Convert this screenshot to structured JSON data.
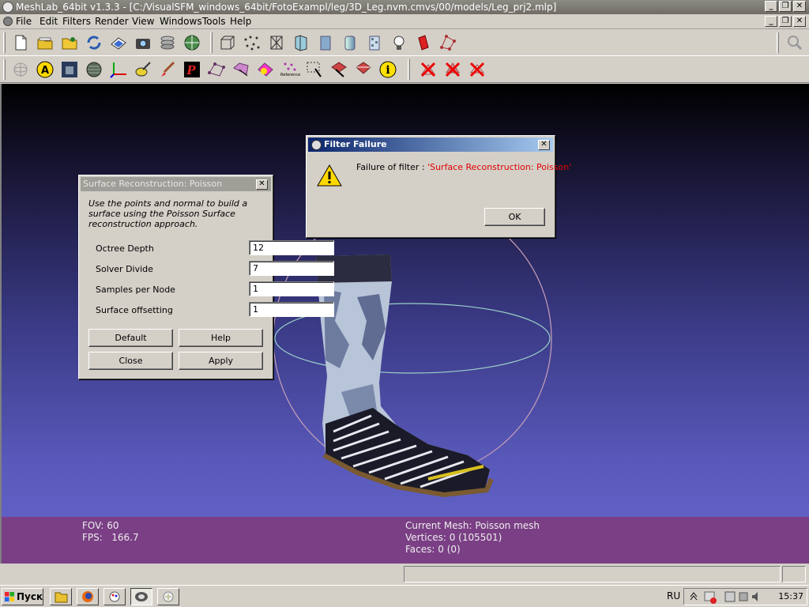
{
  "window": {
    "title": "MeshLab_64bit v1.3.3 - [C:/VisualSFM_windows_64bit/FotoExampl/leg/3D_Leg.nvm.cmvs/00/models/Leg_prj2.mlp]"
  },
  "menu": [
    "File",
    "Edit",
    "Filters",
    "Render",
    "View",
    "Windows",
    "Tools",
    "Help"
  ],
  "toolbar1_icons": [
    "new-project-icon",
    "open-project-icon",
    "open-mesh-icon",
    "reload-icon",
    "save-icon",
    "snapshot-icon",
    "layers-icon",
    "globe-icon",
    "bbox-icon",
    "points-icon",
    "wireframe-icon",
    "hidden-lines-icon",
    "flat-shading-icon",
    "smooth-shading-icon",
    "texture-icon",
    "light-icon",
    "color-icon",
    "vertex-select-icon",
    "search-icon"
  ],
  "toolbar2_icons": [
    "trackball-icon",
    "annotation-icon",
    "texture-proj-icon",
    "globe-edit-icon",
    "axis-icon",
    "measure-icon",
    "paint-icon",
    "pick-points-icon",
    "select-vertices-icon",
    "select-faces-icon",
    "colorize-icon",
    "reference-icon",
    "select-area-icon",
    "select-connected-icon",
    "select-border-icon",
    "info-icon",
    "delete-faces-icon",
    "delete-vertices-icon",
    "delete-selected-icon"
  ],
  "toolbar2_reference_label": "Reference",
  "viewport": {
    "fov_label": "FOV:",
    "fov": "60",
    "fps_label": "FPS:",
    "fps": "166.7",
    "current_mesh": "Current Mesh: Poisson mesh",
    "vertices": "Vertices: 0 (105501)",
    "faces": "Faces: 0 (0)"
  },
  "poisson_dialog": {
    "title": "Surface Reconstruction: Poisson",
    "description": "Use the points and normal to build a surface using the Poisson Surface reconstruction approach.",
    "params": [
      {
        "label": "Octree Depth",
        "value": "12"
      },
      {
        "label": "Solver Divide",
        "value": "7"
      },
      {
        "label": "Samples per Node",
        "value": "1"
      },
      {
        "label": "Surface offsetting",
        "value": "1"
      }
    ],
    "buttons": {
      "default": "Default",
      "help": "Help",
      "close": "Close",
      "apply": "Apply"
    },
    "close_glyph": "✕"
  },
  "failure_dialog": {
    "title": "Filter Failure",
    "message_prefix": "Failure of filter : ",
    "message_filter": "'Surface Reconstruction: Poisson'",
    "ok": "OK",
    "close_glyph": "✕"
  },
  "taskbar": {
    "start": "Пуск",
    "quicklaunch": [
      "explorer-icon",
      "firefox-icon",
      "paint-icon",
      "meshlab-icon",
      "visualsfm-icon"
    ],
    "lang": "RU",
    "clock": "15:37"
  },
  "colors": {
    "info_bg": "#7a3f85",
    "failure_title": "#0a246a",
    "error_text": "#e00000"
  }
}
